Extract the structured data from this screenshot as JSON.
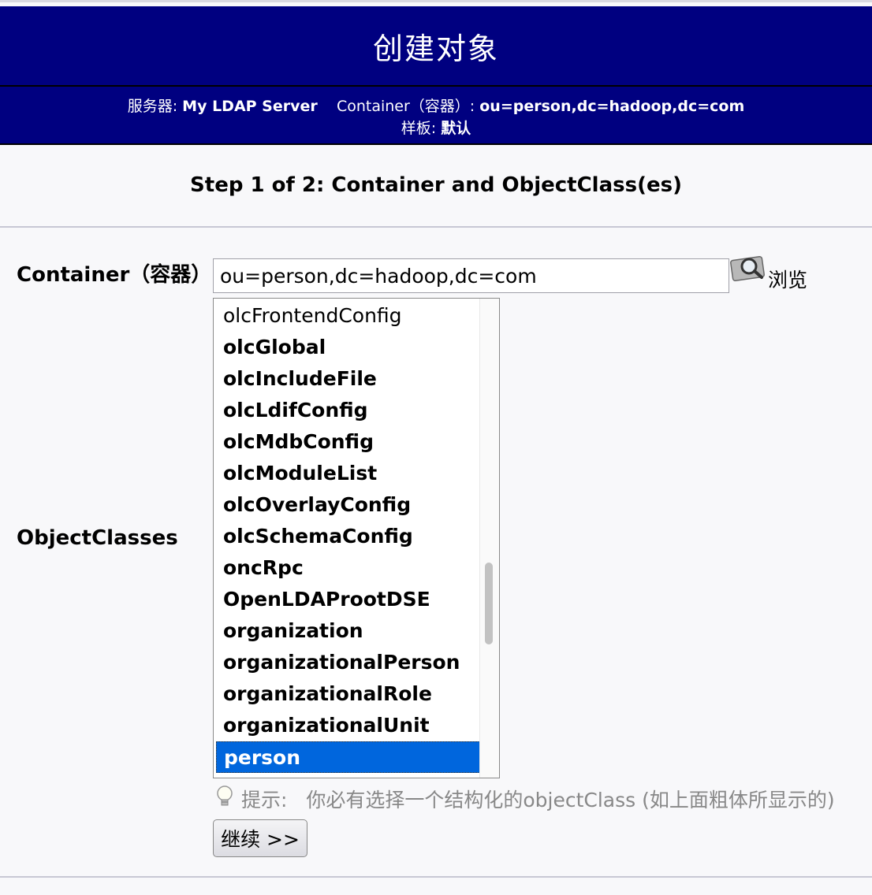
{
  "header": {
    "title": "创建对象",
    "server_label": "服务器:",
    "server_name": "My LDAP Server",
    "container_label": "Container（容器）:",
    "container_value": "ou=person,dc=hadoop,dc=com",
    "template_label": "样板:",
    "template_value": "默认"
  },
  "step_title": "Step 1 of 2: Container and ObjectClass(es)",
  "form": {
    "container_label": "Container（容器）",
    "container_input_value": "ou=person,dc=hadoop,dc=com",
    "browse_label": "浏览",
    "browse_icon": "magnifier-icon",
    "objectclasses_label": "ObjectClasses",
    "objectclasses": [
      {
        "label": "olcFrontendConfig",
        "bold": false
      },
      {
        "label": "olcGlobal",
        "bold": true
      },
      {
        "label": "olcIncludeFile",
        "bold": true
      },
      {
        "label": "olcLdifConfig",
        "bold": true
      },
      {
        "label": "olcMdbConfig",
        "bold": true
      },
      {
        "label": "olcModuleList",
        "bold": true
      },
      {
        "label": "olcOverlayConfig",
        "bold": true
      },
      {
        "label": "olcSchemaConfig",
        "bold": true
      },
      {
        "label": "oncRpc",
        "bold": true
      },
      {
        "label": "OpenLDAProotDSE",
        "bold": true
      },
      {
        "label": "organization",
        "bold": true
      },
      {
        "label": "organizationalPerson",
        "bold": true
      },
      {
        "label": "organizationalRole",
        "bold": true
      },
      {
        "label": "organizationalUnit",
        "bold": true
      },
      {
        "label": "person",
        "bold": true,
        "selected": true
      }
    ],
    "hint_icon": "lightbulb-icon",
    "hint_label": "提示:",
    "hint_text": "你必有选择一个结构化的objectClass (如上面粗体所显示的)",
    "continue_label": "继续 >>"
  },
  "colors": {
    "header_bg": "#000080",
    "selected_bg": "#0066dd",
    "page_bg": "#f8f8fa"
  }
}
